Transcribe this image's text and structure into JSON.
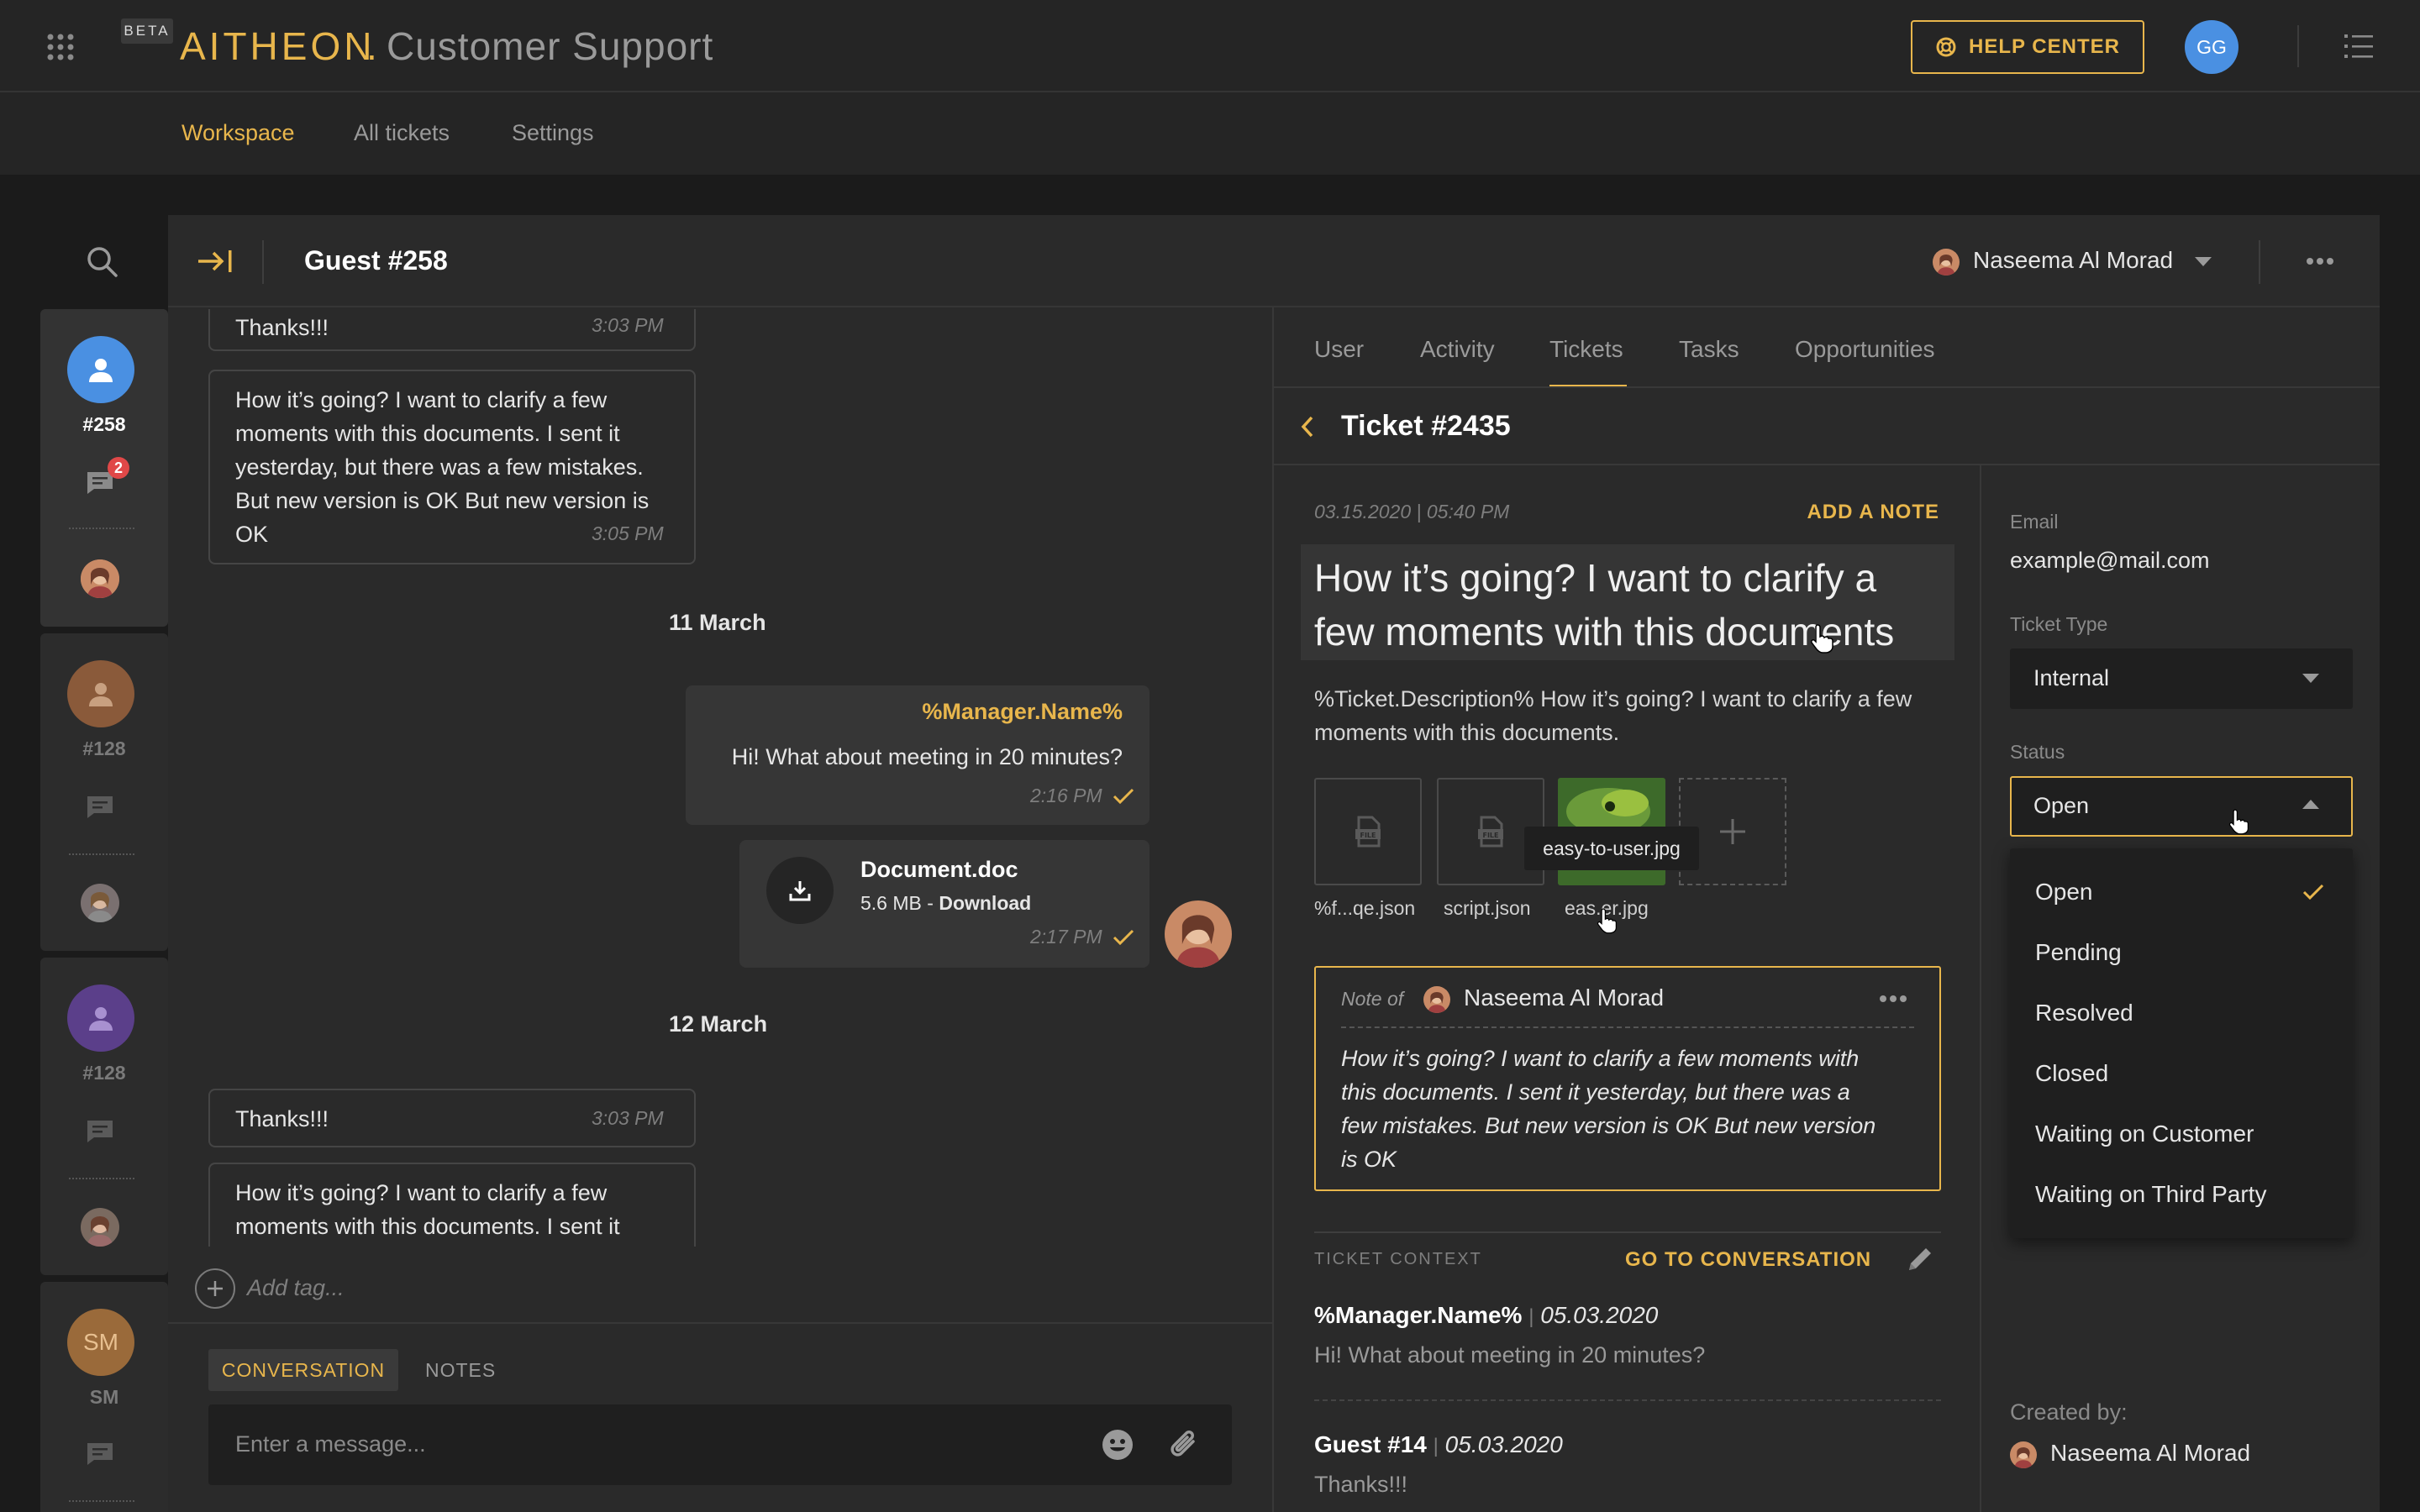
{
  "app": {
    "beta": "BETA",
    "brand": "AITHEON",
    "dot": ".",
    "title": "Customer Support",
    "help_center": "HELP CENTER",
    "user_initials": "GG"
  },
  "nav": {
    "items": [
      "Workspace",
      "All tickets",
      "Settings"
    ],
    "active": "Workspace"
  },
  "rail": {
    "conversations": [
      {
        "label": "#258",
        "badge": "2",
        "color": "#4a90e2"
      },
      {
        "label": "#128",
        "color": "#8a5a3a"
      },
      {
        "label": "#128",
        "color": "#5b3f8a"
      },
      {
        "label": "SM",
        "initials": "SM",
        "color": "#9a6a3a"
      }
    ]
  },
  "conversation": {
    "title": "Guest #258",
    "messages": {
      "m1": {
        "text": "Thanks!!!",
        "time": "3:03 PM"
      },
      "m2": {
        "lines": [
          "How it’s going? I want to clarify a few",
          "moments with this documents. I sent it",
          "yesterday, but there was a few mistakes.",
          "But new version is OK But new version is",
          "OK"
        ],
        "time": "3:05 PM"
      },
      "date1": "11 March",
      "m3": {
        "sender": "%Manager.Name%",
        "text": "Hi! What about meeting in 20 minutes?",
        "time": "2:16 PM"
      },
      "m4": {
        "file": "Document.doc",
        "size": "5.6 MB",
        "sep": " - ",
        "action": "Download",
        "time": "2:17 PM"
      },
      "date2": "12 March",
      "m5": {
        "text": "Thanks!!!",
        "time": "3:03 PM"
      },
      "m6": {
        "lines": [
          "How it’s going? I want to clarify a few",
          "moments with this documents. I sent it"
        ]
      }
    },
    "add_tag": "Add tag...",
    "composer": {
      "tab_active": "CONVERSATION",
      "tab_other": "NOTES",
      "placeholder": "Enter a message..."
    }
  },
  "agent": {
    "name": "Naseema Al Morad"
  },
  "details": {
    "tabs": [
      "User",
      "Activity",
      "Tickets",
      "Tasks",
      "Opportunities"
    ],
    "active_tab": "Tickets",
    "ticket": {
      "title": "Ticket #2435",
      "timestamp": "03.15.2020 | 05:40 PM",
      "add_note": "ADD A NOTE",
      "subject_lines": [
        "How it’s going? I want to clarify a",
        "few moments with this documents"
      ],
      "description_lines": [
        "%Ticket.Description% How it’s going? I want to clarify a few",
        "moments with this documents."
      ],
      "attachments": [
        "%f...qe.json",
        "script.json",
        "eas.er.jpg"
      ],
      "tooltip": "easy-to-user.jpg",
      "note": {
        "prefix": "Note of",
        "author": "Naseema Al Morad",
        "lines": [
          "How it’s going? I want to clarify a few moments with",
          "this documents. I sent it yesterday, but there was a",
          "few mistakes. But new version is OK But new version",
          "is OK"
        ]
      },
      "context": {
        "label": "TICKET CONTEXT",
        "go": "GO TO CONVERSATION",
        "entries": [
          {
            "sender": "%Manager.Name%",
            "sep": "|",
            "date": "05.03.2020",
            "text": "Hi! What about meeting in 20 minutes?"
          },
          {
            "sender": "Guest #14",
            "sep": "|",
            "date": "05.03.2020",
            "text": "Thanks!!!"
          }
        ]
      }
    },
    "fields": {
      "email_label": "Email",
      "email": "example@mail.com",
      "type_label": "Ticket Type",
      "type": "Internal",
      "status_label": "Status",
      "status": "Open",
      "status_options": [
        "Open",
        "Pending",
        "Resolved",
        "Closed",
        "Waiting on Customer",
        "Waiting on Third Party"
      ],
      "created_label": "Created by:",
      "created_by": "Naseema Al Morad"
    }
  }
}
